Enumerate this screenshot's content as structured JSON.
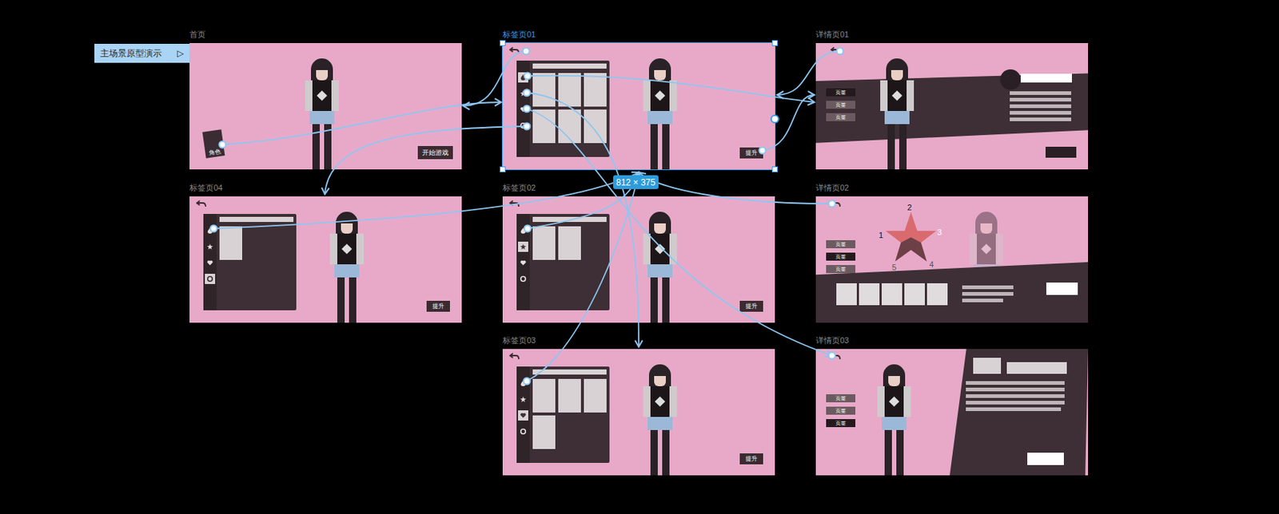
{
  "canvas_badge": {
    "label": "主场景原型演示",
    "icon": "▷"
  },
  "size_badge": "812 × 375",
  "frames": [
    {
      "name": "首页",
      "kind": "home",
      "selected": false,
      "card_label": "角色",
      "button": "开始游戏"
    },
    {
      "name": "标签页01",
      "kind": "tabs",
      "selected": true,
      "tabs": [
        {
          "selected": true
        },
        {
          "selected": false
        },
        {
          "selected": false
        },
        {
          "selected": false
        }
      ],
      "tile_count": 6,
      "button": "提升"
    },
    {
      "name": "详情页01",
      "kind": "detail1",
      "selected": false,
      "tabs": [
        {
          "label": "页签",
          "selected": true
        },
        {
          "label": "页签",
          "selected": false
        },
        {
          "label": "页签",
          "selected": false
        }
      ]
    },
    {
      "name": "标签页04",
      "kind": "tabs",
      "selected": false,
      "tabs": [
        {
          "selected": false
        },
        {
          "selected": false
        },
        {
          "selected": false
        },
        {
          "selected": true
        }
      ],
      "tile_count": 1,
      "button": "提升"
    },
    {
      "name": "标签页02",
      "kind": "tabs",
      "selected": false,
      "tabs": [
        {
          "selected": false
        },
        {
          "selected": true
        },
        {
          "selected": false
        },
        {
          "selected": false
        }
      ],
      "tile_count": 2,
      "button": "提升"
    },
    {
      "name": "详情页02",
      "kind": "detail2",
      "selected": false,
      "tabs": [
        {
          "label": "页签",
          "selected": false
        },
        {
          "label": "页签",
          "selected": true
        },
        {
          "label": "页签",
          "selected": false
        }
      ],
      "axis_labels": [
        "1",
        "2",
        "3",
        "4",
        "5"
      ]
    },
    {
      "name": "标签页03",
      "kind": "tabs",
      "selected": false,
      "tabs": [
        {
          "selected": false
        },
        {
          "selected": false
        },
        {
          "selected": true
        },
        {
          "selected": false
        }
      ],
      "tile_count": 4,
      "button": "提升"
    },
    {
      "name": "详情页03",
      "kind": "detail3",
      "selected": false,
      "tabs": [
        {
          "label": "页签",
          "selected": false
        },
        {
          "label": "页签",
          "selected": false
        },
        {
          "label": "页签",
          "selected": true
        }
      ]
    }
  ]
}
